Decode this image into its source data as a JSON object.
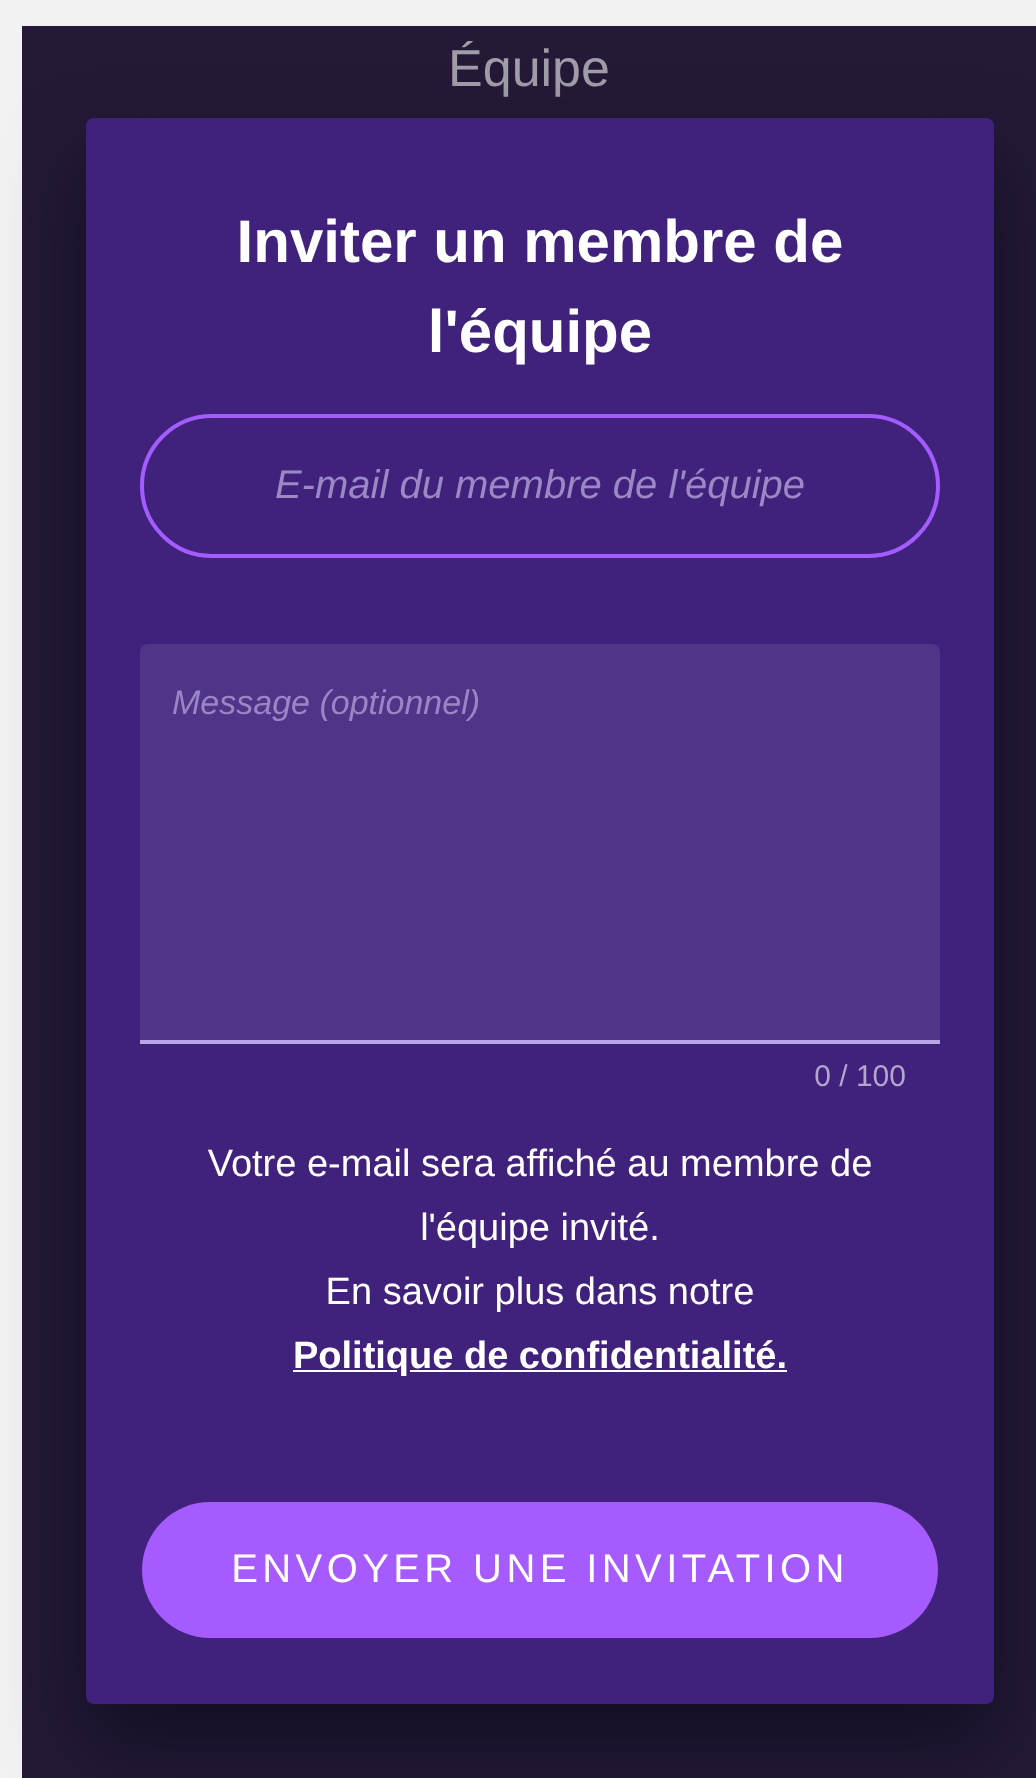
{
  "page": {
    "title": "Équipe"
  },
  "dialog": {
    "title": "Inviter un membre de l'équipe",
    "email_field": {
      "placeholder": "E-mail du membre de l'équipe"
    },
    "message_field": {
      "placeholder": "Message (optionnel)",
      "counter": "0 / 100"
    },
    "notice": "Votre e-mail sera affiché au membre de l'équipe invité.",
    "privacy_intro": "En savoir plus dans notre",
    "privacy_link": "Politique de confidentialité.",
    "submit_button": "ENVOYER UNE INVITATION"
  }
}
